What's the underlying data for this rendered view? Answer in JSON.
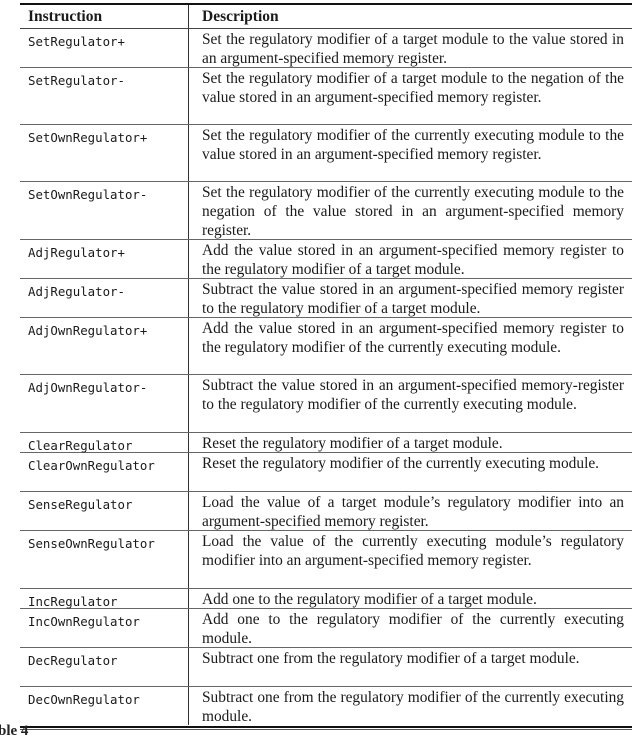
{
  "table": {
    "headers": {
      "instruction": "Instruction",
      "description": "Description"
    },
    "rows": [
      {
        "instruction": "SetRegulator+",
        "description": "Set the regulatory modifier of a target module to the value stored in an argument-specified memory register."
      },
      {
        "instruction": "SetRegulator-",
        "description": "Set the regulatory modifier of a target module to the negation of the value stored in an argument-specified memory register."
      },
      {
        "instruction": "SetOwnRegulator+",
        "description": "Set the regulatory modifier of the currently executing module to the value stored in an argument-specified memory register."
      },
      {
        "instruction": "SetOwnRegulator-",
        "description": "Set the regulatory modifier of the currently executing module to the negation of the value stored in an argument-specified memory register."
      },
      {
        "instruction": "AdjRegulator+",
        "description": "Add the value stored in an argument-specified memory register to the regulatory modifier of a target module."
      },
      {
        "instruction": "AdjRegulator-",
        "description": "Subtract the value stored in an argument-specified memory register to the regulatory modifier of a target module."
      },
      {
        "instruction": "AdjOwnRegulator+",
        "description": "Add the value stored in an argument-specified memory register to the regulatory modifier of the currently executing module."
      },
      {
        "instruction": "AdjOwnRegulator-",
        "description": "Subtract the value stored in an argument-specified memory-register to the regulatory modifier of the currently executing module."
      },
      {
        "instruction": "ClearRegulator",
        "description": "Reset the regulatory modifier of a target module."
      },
      {
        "instruction": "ClearOwnRegulator",
        "description": "Reset the regulatory modifier of the currently executing module."
      },
      {
        "instruction": "SenseRegulator",
        "description": "Load the value of a target module’s regulatory modifier into an argument-specified memory register."
      },
      {
        "instruction": "SenseOwnRegulator",
        "description": "Load the value of the currently executing module’s regulatory modifier into an argument-specified memory register."
      },
      {
        "instruction": "IncRegulator",
        "description": "Add one to the regulatory modifier of a target module."
      },
      {
        "instruction": "IncOwnRegulator",
        "description": "Add one to the regulatory modifier of the currently executing module."
      },
      {
        "instruction": "DecRegulator",
        "description": "Subtract one from the regulatory modifier of a target module."
      },
      {
        "instruction": "DecOwnRegulator",
        "description": "Subtract one from the regulatory modifier of the currently executing module."
      }
    ]
  },
  "caption_fragment": "ble 4"
}
